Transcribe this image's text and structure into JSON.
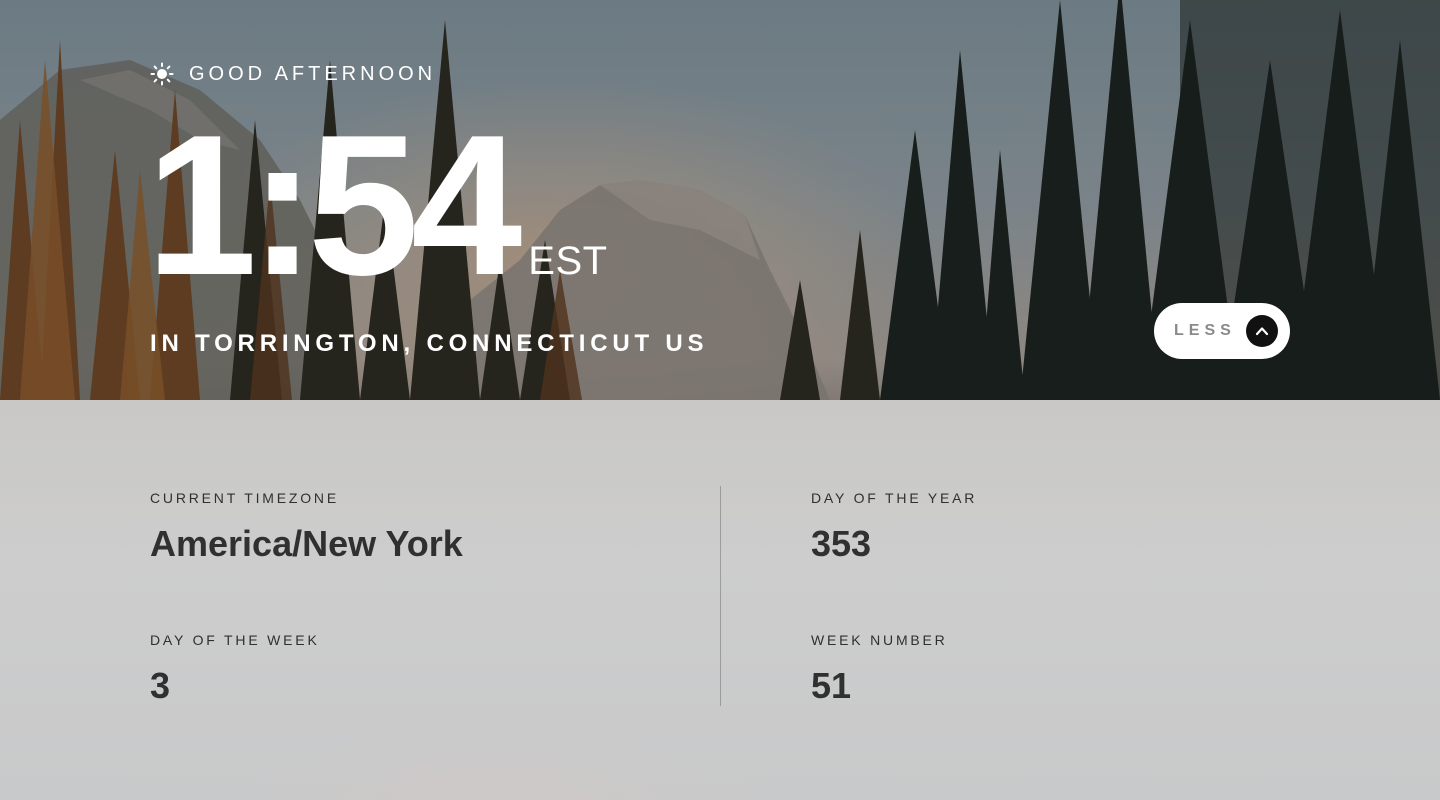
{
  "greeting": {
    "icon": "sun-icon",
    "text": "Good afternoon"
  },
  "clock": {
    "time": "1:54",
    "abbreviation": "EST"
  },
  "location": {
    "text": "In Torrington, Connecticut US"
  },
  "toggle": {
    "label": "Less",
    "icon": "chevron-up-icon"
  },
  "details": {
    "timezone": {
      "label": "Current timezone",
      "value": "America/New York"
    },
    "day_of_year": {
      "label": "Day of the year",
      "value": "353"
    },
    "day_of_week": {
      "label": "Day of the week",
      "value": "3"
    },
    "week_number": {
      "label": "Week number",
      "value": "51"
    }
  },
  "colors": {
    "text_light": "#ffffff",
    "text_dark": "#303030",
    "button_bg": "#ffffff",
    "button_icon_bg": "#111111",
    "button_label": "#8a8a8a"
  }
}
